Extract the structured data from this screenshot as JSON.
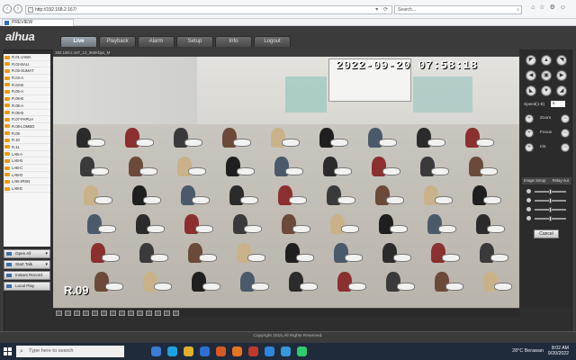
{
  "browser": {
    "url": "http://192.168.2.167/",
    "search_placeholder": "Search...",
    "tab_title": "PREVIEW"
  },
  "app": {
    "logo": "alhua",
    "nav": [
      "Live",
      "Playback",
      "Alarm",
      "Setup",
      "Info",
      "Logout"
    ],
    "active_nav": "Live",
    "cameras": [
      "R.01-JAWA",
      "R.02-BALI",
      "R.03-SUMAT",
      "R.04-A",
      "R.04-B",
      "R.05-A",
      "R.05-B",
      "R.06-A",
      "R.06-B",
      "R.07-PAPUA",
      "R.08-LOMBO",
      "R.09",
      "R.10",
      "R.11",
      "LAB-A",
      "LAB-B",
      "LAB-C",
      "LAB-D",
      "LAB-JRSN",
      "LAB-E"
    ],
    "left_buttons": [
      "Open All",
      "Start Talk",
      "Instant Record",
      "Local Play"
    ],
    "video": {
      "header": "192.168.2.167_12_960Kbps_M",
      "timestamp": "2022-09-20 07:58:18",
      "room_label": "R.09"
    },
    "ptz": {
      "speed_label": "Speed(1-8)",
      "speed_value": "5",
      "zoom": "Zoom",
      "focus": "Focus",
      "iris": "Iris",
      "image_setup": "Image Setup",
      "relay_out": "Relay-out",
      "cancel": "Cancel"
    },
    "footer": "Copyright 2015,All Rights Reserved."
  },
  "taskbar": {
    "search_placeholder": "Type here to search",
    "weather": "28°C  Berawan",
    "time": "8:02 AM",
    "date": "9/20/2022"
  }
}
